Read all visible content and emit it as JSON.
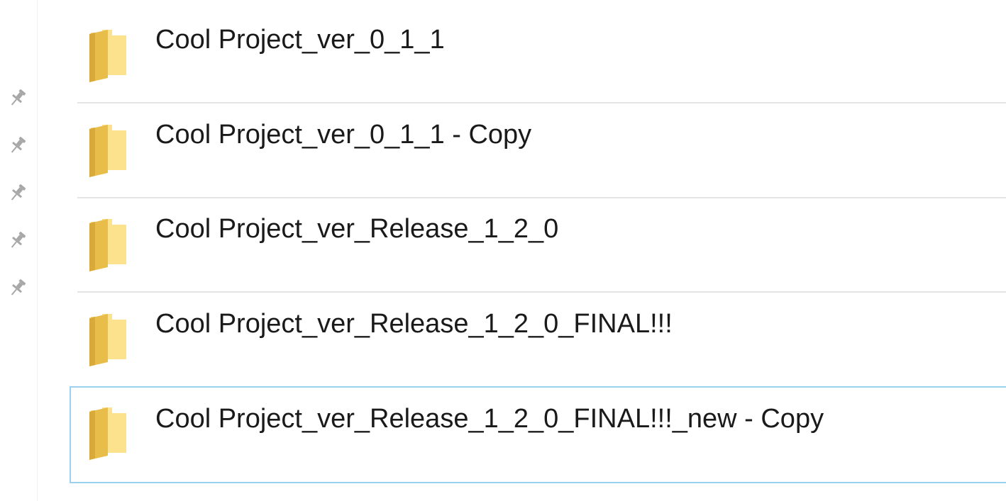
{
  "navigation_pane": {
    "pinned_icons": [
      "pin-icon",
      "pin-icon",
      "pin-icon",
      "pin-icon",
      "pin-icon"
    ]
  },
  "file_list": {
    "items": [
      {
        "name": "Cool Project_ver_0_1_1",
        "type": "folder",
        "icon": "folder-icon",
        "selected": false
      },
      {
        "name": "Cool Project_ver_0_1_1 - Copy",
        "type": "folder",
        "icon": "folder-icon",
        "selected": false
      },
      {
        "name": "Cool Project_ver_Release_1_2_0",
        "type": "folder",
        "icon": "folder-icon",
        "selected": false
      },
      {
        "name": "Cool Project_ver_Release_1_2_0_FINAL!!!",
        "type": "folder",
        "icon": "folder-icon",
        "selected": false
      },
      {
        "name": "Cool Project_ver_Release_1_2_0_FINAL!!!_new - Copy",
        "type": "folder",
        "icon": "folder-icon",
        "selected": true
      }
    ]
  },
  "colors": {
    "folder_light": "#fde28e",
    "folder_dark": "#e8bd4a",
    "separator": "#e5e5e5",
    "selection_border": "#99d1ee",
    "pin": "#a8a8a8"
  }
}
